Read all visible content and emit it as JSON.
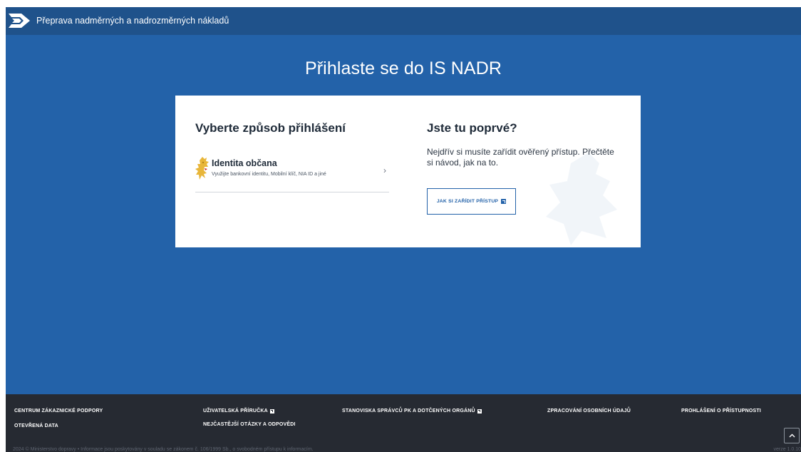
{
  "header": {
    "app_title": "Přeprava nadměrných a nadrozměrných nákladů",
    "logo_icon": "road-sign-arrow-icon"
  },
  "main": {
    "heading": "Přihlaste se do IS NADR"
  },
  "login": {
    "heading": "Vyberte způsob přihlášení",
    "options": [
      {
        "title": "Identita občana",
        "description": "Využijte bankovní identitu, Mobilní klíč, NIA ID a jiné",
        "icon": "czech-lion-icon"
      }
    ]
  },
  "first_time": {
    "heading": "Jste tu poprvé?",
    "text": "Nejdřív si musíte zařídit ověřený přístup. Přečtěte si návod, jak na to.",
    "button_label": "JAK SI ZAŘÍDIT PŘÍSTUP"
  },
  "footer": {
    "links": {
      "support": "CENTRUM ZÁKAZNICKÉ PODPORY",
      "open_data": "OTEVŘENÁ DATA",
      "manual": "UŽIVATELSKÁ PŘÍRUČKA",
      "faq": "NEJČASTĚJŠÍ OTÁZKY A ODPOVĚDI",
      "statements": "STANOVISKA SPRÁVCŮ PK A DOTČENÝCH ORGÁNŮ",
      "personal_data": "ZPRACOVÁNÍ OSOBNÍCH ÚDAJŮ",
      "accessibility": "PROHLÁŠENÍ O PŘÍSTUPNOSTI"
    },
    "copyright": "2024 © Ministerstvo dopravy • Informace jsou poskytovány v souladu se zákonem č. 106/1999 Sb., o svobodném přístupu k informacím.",
    "version": "verze 1.0.10"
  },
  "colors": {
    "primary": "#2362a9",
    "header_bar": "#1f528b",
    "footer": "#262a32",
    "lion_gold": "#e8b63a"
  }
}
